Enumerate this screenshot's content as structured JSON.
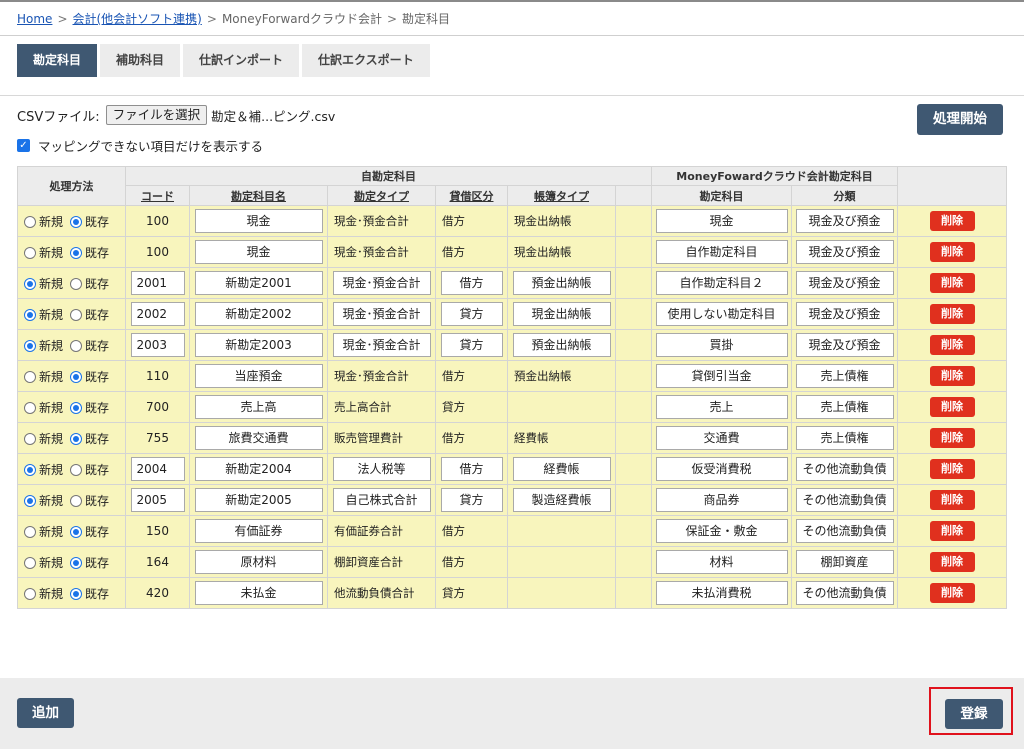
{
  "breadcrumb": {
    "home": "Home",
    "accounting": "会計(他会計ソフト連携)",
    "mf": "MoneyForwardクラウド会計",
    "current": "勘定科目",
    "sep": ">"
  },
  "tabs": [
    "勘定科目",
    "補助科目",
    "仕訳インポート",
    "仕訳エクスポート"
  ],
  "csv": {
    "label": "CSVファイル:",
    "button": "ファイルを選択",
    "filename": "勘定＆補...ピング.csv",
    "checkbox_label": "マッピングできない項目だけを表示する",
    "checkbox_checked": true
  },
  "start_button": "処理開始",
  "table": {
    "group_own": "自勘定科目",
    "group_mf": "MoneyFowardクラウド会計勘定科目",
    "col_method": "処理方法",
    "col_code": "コード",
    "col_name": "勘定科目名",
    "col_type": "勘定タイプ",
    "col_side": "貸借区分",
    "col_book": "帳簿タイプ",
    "col_mf_account": "勘定科目",
    "col_mf_category": "分類",
    "radio_new": "新規",
    "radio_existing": "既存",
    "delete_label": "削除",
    "rows": [
      {
        "mode": "existing",
        "code": "100",
        "name": "現金",
        "type": "現金･預金合計",
        "side": "借方",
        "book": "現金出納帳",
        "mf_account": "現金",
        "mf_category": "現金及び預金"
      },
      {
        "mode": "existing",
        "code": "100",
        "name": "現金",
        "type": "現金･預金合計",
        "side": "借方",
        "book": "現金出納帳",
        "mf_account": "自作勘定科目",
        "mf_category": "現金及び預金"
      },
      {
        "mode": "new",
        "code": "2001",
        "name": "新勘定2001",
        "type": "現金･預金合計",
        "side": "借方",
        "book": "預金出納帳",
        "mf_account": "自作勘定科目２",
        "mf_category": "現金及び預金"
      },
      {
        "mode": "new",
        "code": "2002",
        "name": "新勘定2002",
        "type": "現金･預金合計",
        "side": "貸方",
        "book": "現金出納帳",
        "mf_account": "使用しない勘定科目",
        "mf_category": "現金及び預金"
      },
      {
        "mode": "new",
        "code": "2003",
        "name": "新勘定2003",
        "type": "現金･預金合計",
        "side": "貸方",
        "book": "預金出納帳",
        "mf_account": "買掛",
        "mf_category": "現金及び預金"
      },
      {
        "mode": "existing",
        "code": "110",
        "name": "当座預金",
        "type": "現金･預金合計",
        "side": "借方",
        "book": "預金出納帳",
        "mf_account": "貸倒引当金",
        "mf_category": "売上債権"
      },
      {
        "mode": "existing",
        "code": "700",
        "name": "売上高",
        "type": "売上高合計",
        "side": "貸方",
        "book": "",
        "mf_account": "売上",
        "mf_category": "売上債権"
      },
      {
        "mode": "existing",
        "code": "755",
        "name": "旅費交通費",
        "type": "販売管理費計",
        "side": "借方",
        "book": "経費帳",
        "mf_account": "交通費",
        "mf_category": "売上債権"
      },
      {
        "mode": "new",
        "code": "2004",
        "name": "新勘定2004",
        "type": "法人税等",
        "side": "借方",
        "book": "経費帳",
        "mf_account": "仮受消費税",
        "mf_category": "その他流動負債"
      },
      {
        "mode": "new",
        "code": "2005",
        "name": "新勘定2005",
        "type": "自己株式合計",
        "side": "貸方",
        "book": "製造経費帳",
        "mf_account": "商品券",
        "mf_category": "その他流動負債"
      },
      {
        "mode": "existing",
        "code": "150",
        "name": "有価証券",
        "type": "有価証券合計",
        "side": "借方",
        "book": "",
        "mf_account": "保証金・敷金",
        "mf_category": "その他流動負債"
      },
      {
        "mode": "existing",
        "code": "164",
        "name": "原材料",
        "type": "棚卸資産合計",
        "side": "借方",
        "book": "",
        "mf_account": "材料",
        "mf_category": "棚卸資産"
      },
      {
        "mode": "existing",
        "code": "420",
        "name": "未払金",
        "type": "他流動負債合計",
        "side": "貸方",
        "book": "",
        "mf_account": "未払消費税",
        "mf_category": "その他流動負債"
      }
    ]
  },
  "footer": {
    "add": "追加",
    "register": "登録"
  }
}
